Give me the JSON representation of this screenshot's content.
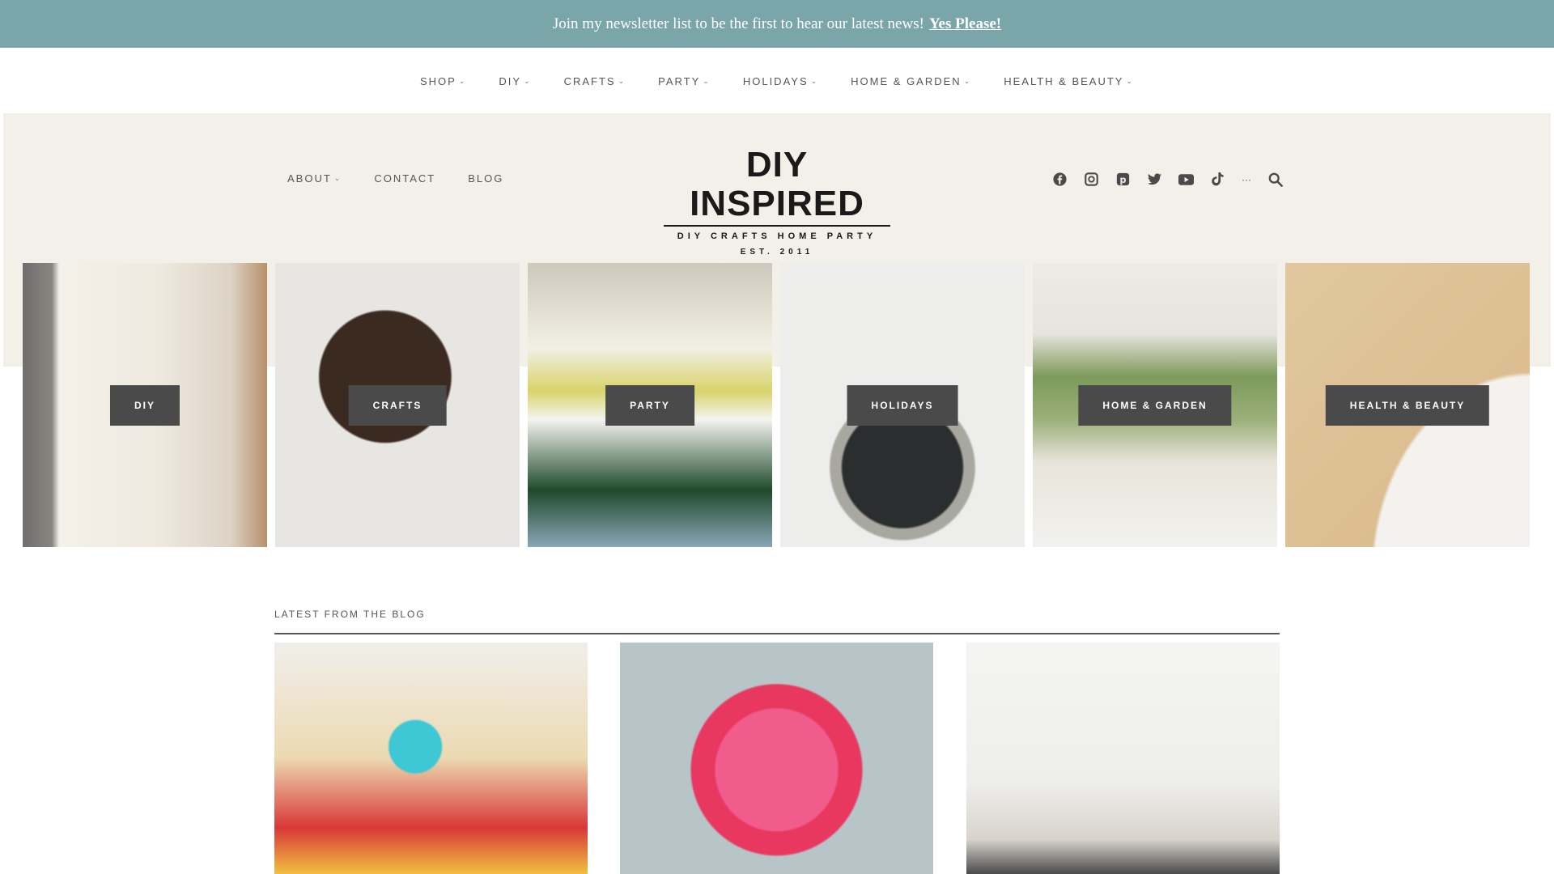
{
  "banner": {
    "text": "Join my newsletter list to be the first to hear our latest news!",
    "link": "Yes Please!"
  },
  "main_nav": [
    {
      "label": "SHOP"
    },
    {
      "label": "DIY"
    },
    {
      "label": "CRAFTS"
    },
    {
      "label": "PARTY"
    },
    {
      "label": "HOLIDAYS"
    },
    {
      "label": "HOME & GARDEN"
    },
    {
      "label": "HEALTH & BEAUTY"
    }
  ],
  "secondary_nav": [
    {
      "label": "ABOUT",
      "dropdown": true
    },
    {
      "label": "CONTACT"
    },
    {
      "label": "BLOG"
    }
  ],
  "logo": {
    "title": "DIY INSPIRED",
    "tagline": "DIY CRAFTS HOME PARTY",
    "est": "EST. 2011"
  },
  "social_icons": [
    "facebook-icon",
    "instagram-icon",
    "pinterest-icon",
    "twitter-icon",
    "youtube-icon",
    "tiktok-icon",
    "more-icon",
    "search-icon"
  ],
  "categories": [
    {
      "label": "DIY"
    },
    {
      "label": "CRAFTS"
    },
    {
      "label": "PARTY"
    },
    {
      "label": "HOLIDAYS"
    },
    {
      "label": "HOME & GARDEN"
    },
    {
      "label": "HEALTH & BEAUTY"
    }
  ],
  "blog": {
    "heading": "LATEST FROM THE BLOG"
  },
  "colors": {
    "banner": "#7aa6aa",
    "header_bg": "#f3f0ea",
    "label_bg": "#4a4a4a"
  }
}
